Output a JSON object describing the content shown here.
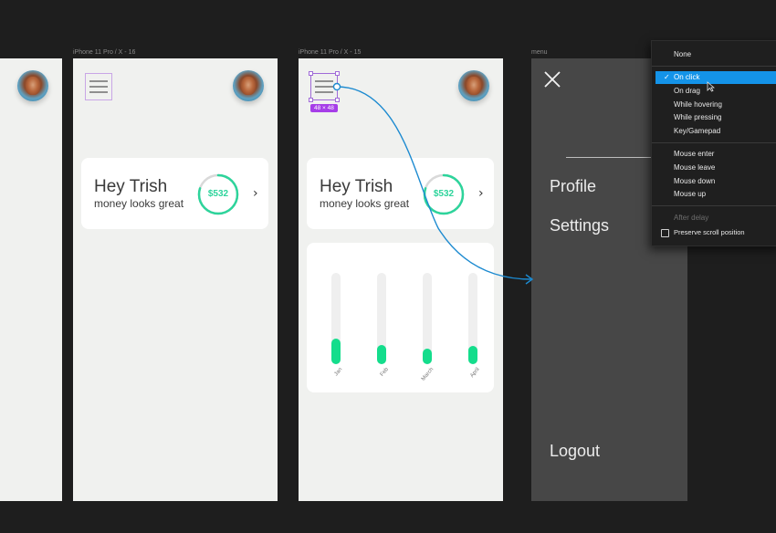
{
  "frames": {
    "frame1": {
      "label": "iPhone 11 Pro / X - 16"
    },
    "frame2": {
      "label": "iPhone 11 Pro / X - 15"
    },
    "menu": {
      "label": "menu"
    }
  },
  "greeting": {
    "title": "Hey Trish",
    "subtitle": "money looks great",
    "amount": "$532",
    "ring_progress": 0.8
  },
  "selection": {
    "size_badge": "48 × 48"
  },
  "chart": {
    "bars": [
      {
        "label": "Jan",
        "value": 0.28
      },
      {
        "label": "Feb",
        "value": 0.21
      },
      {
        "label": "March",
        "value": 0.17
      },
      {
        "label": "April",
        "value": 0.2
      }
    ]
  },
  "menu": {
    "items": [
      "Profile",
      "Settings"
    ],
    "logout": "Logout"
  },
  "trigger_dropdown": {
    "none": "None",
    "groups": [
      [
        "On click",
        "On drag",
        "While hovering",
        "While pressing",
        "Key/Gamepad"
      ],
      [
        "Mouse enter",
        "Mouse leave",
        "Mouse down",
        "Mouse up"
      ]
    ],
    "selected": "On click",
    "after_delay": "After delay",
    "preserve_scroll": {
      "label": "Preserve scroll position",
      "checked": false
    }
  },
  "colors": {
    "accent_green": "#14dd8c",
    "ring_green": "#2dd49b",
    "selection_blue": "#1493e8",
    "prototype_link": "#1c8ad0",
    "badge_purple": "#a63ee8"
  }
}
